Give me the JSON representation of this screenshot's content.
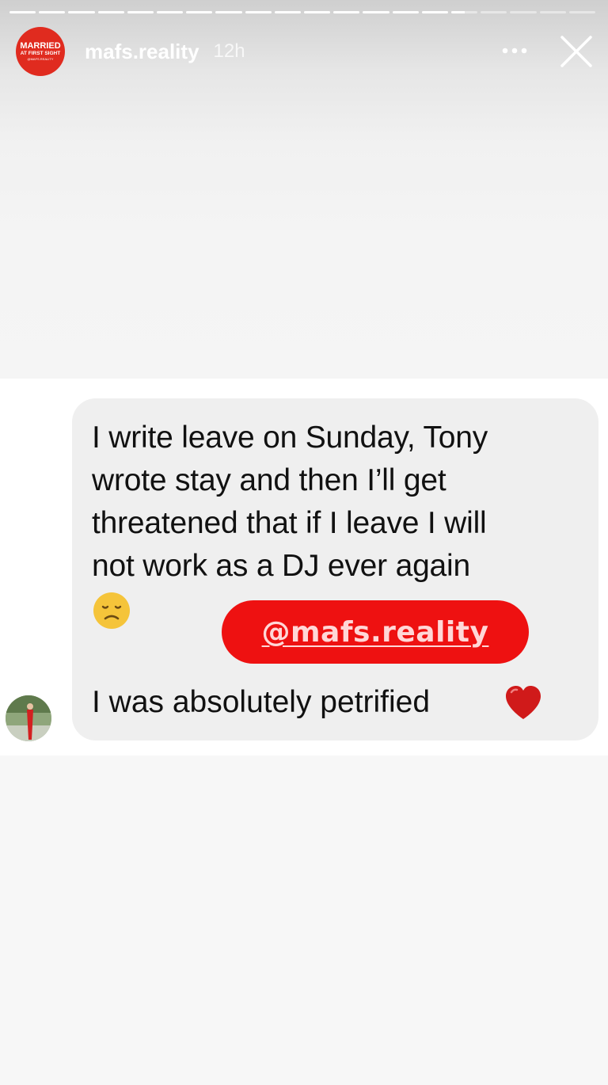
{
  "story": {
    "progress_segments": 20,
    "current_segment": 15,
    "current_segment_progress": 0.5,
    "header": {
      "logo_text": [
        "MARRIED",
        "AT FIRST SIGHT",
        "@MAFS.REALITY"
      ],
      "username": "mafs.reality",
      "timestamp": "12h",
      "more_icon": "more-horizontal-icon",
      "close_icon": "close-icon"
    },
    "message": {
      "lines": [
        "I write leave on Sunday,  Tony",
        "wrote stay and then I’ll get",
        "threatened that if I leave I will",
        "not work as a DJ ever again"
      ],
      "emoji": "disappointed-face-icon",
      "last_line": "I was absolutely petrified",
      "heart_icon": "red-heart-icon"
    },
    "mention_sticker": "@mafs.reality"
  },
  "colors": {
    "brand_red": "#e02b1f",
    "mention_red": "#ee1111",
    "bubble_gray": "#efefef",
    "heart_red": "#d01a1a",
    "emoji_yellow": "#f5c43a"
  }
}
